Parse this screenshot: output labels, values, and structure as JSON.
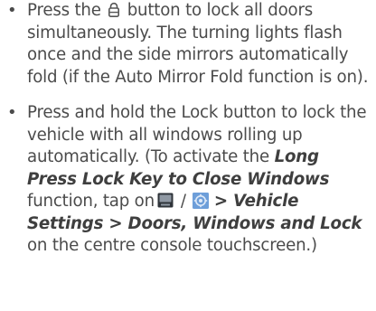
{
  "instructions": {
    "item1": {
      "prefix": "Press the",
      "lock_icon": "lock-icon",
      "suffix": "button to lock all doors simultaneously. The turning lights flash once and the side mirrors automatically fold (if the Auto Mirror Fold function is on)."
    },
    "item2": {
      "text1": "Press and hold the Lock button to lock the vehicle with all windows rolling up automatically. (To activate the",
      "bold1": "Long Press Lock Key to Close Windows",
      "text2": "function, tap on",
      "icon1": "screen-icon",
      "separator": "/",
      "icon2": "settings-icon",
      "path_prefix": "> Vehicle Settings > Doors, Windows and Lock",
      "text3": "on the centre console touchscreen.)"
    }
  },
  "bullet_symbol": "•",
  "colors": {
    "text": "#4b4b4b",
    "emphasis": "#3f3f3f",
    "icon_dark": "#3a3f46",
    "icon_blue": "#6d9ed9"
  }
}
